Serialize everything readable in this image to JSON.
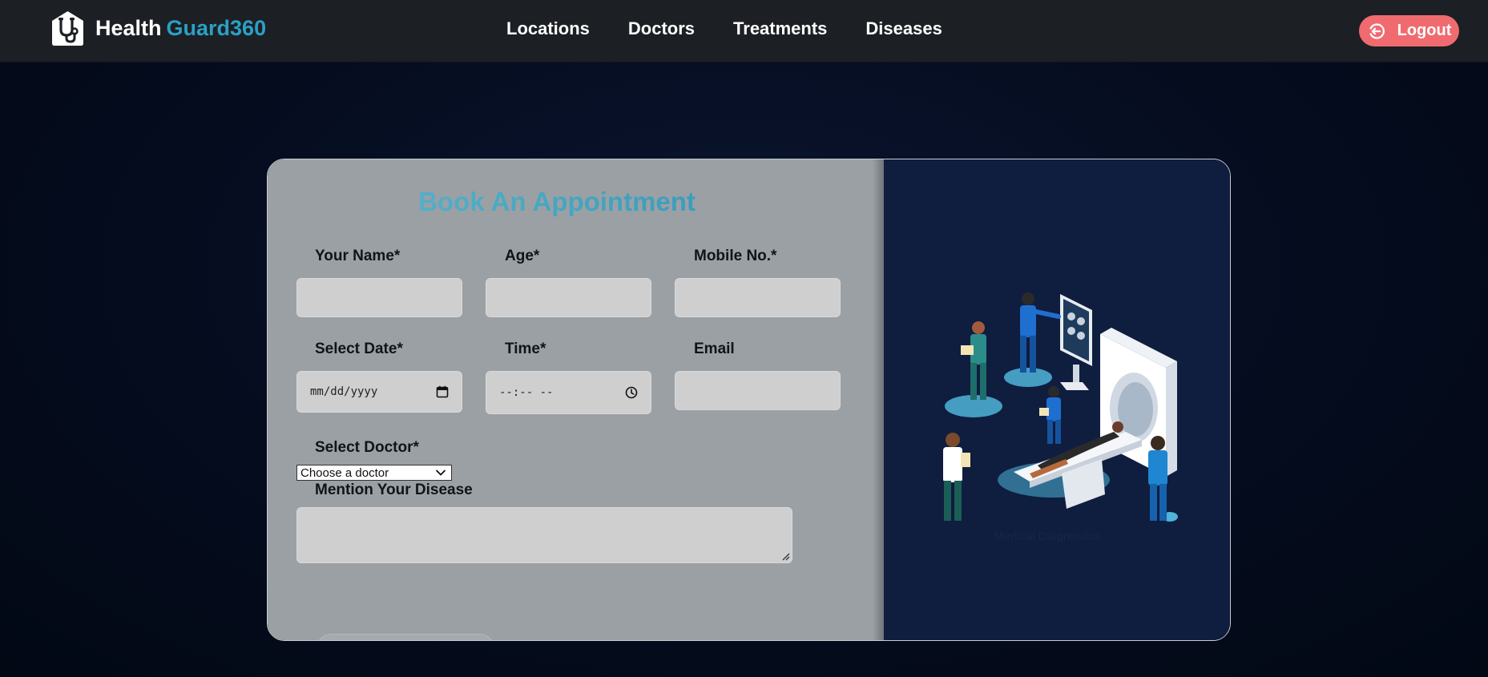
{
  "brand": {
    "word1": "Health",
    "word2": "Guard360",
    "logo_icon": "stethoscope-house-icon"
  },
  "nav": {
    "items": [
      "Locations",
      "Doctors",
      "Treatments",
      "Diseases"
    ]
  },
  "logout": {
    "label": "Logout",
    "icon": "logout-icon"
  },
  "form": {
    "title": "Book An Appointment",
    "fields": {
      "name": {
        "label": "Your Name*",
        "value": ""
      },
      "age": {
        "label": "Age*",
        "value": ""
      },
      "mobile": {
        "label": "Mobile No.*",
        "value": ""
      },
      "date": {
        "label": "Select Date*",
        "placeholder": "mm/dd/yyyy",
        "icon": "calendar-icon"
      },
      "time": {
        "label": "Time*",
        "placeholder": "--:-- --",
        "icon": "clock-icon"
      },
      "email": {
        "label": "Email",
        "value": ""
      },
      "doctor": {
        "label": "Select Doctor*",
        "selected": "Choose a doctor"
      },
      "disease": {
        "label": "Mention Your Disease",
        "value": ""
      }
    }
  },
  "illustration": {
    "caption": "Medical Diagnostics",
    "icon": "medical-team-mri-illustration"
  },
  "colors": {
    "navbar": "#1c1f24",
    "accent": "#2ba0c4",
    "logout": "#f06b6f",
    "form_panel": "#9ba0a5",
    "image_panel": "#0f1d3f"
  }
}
